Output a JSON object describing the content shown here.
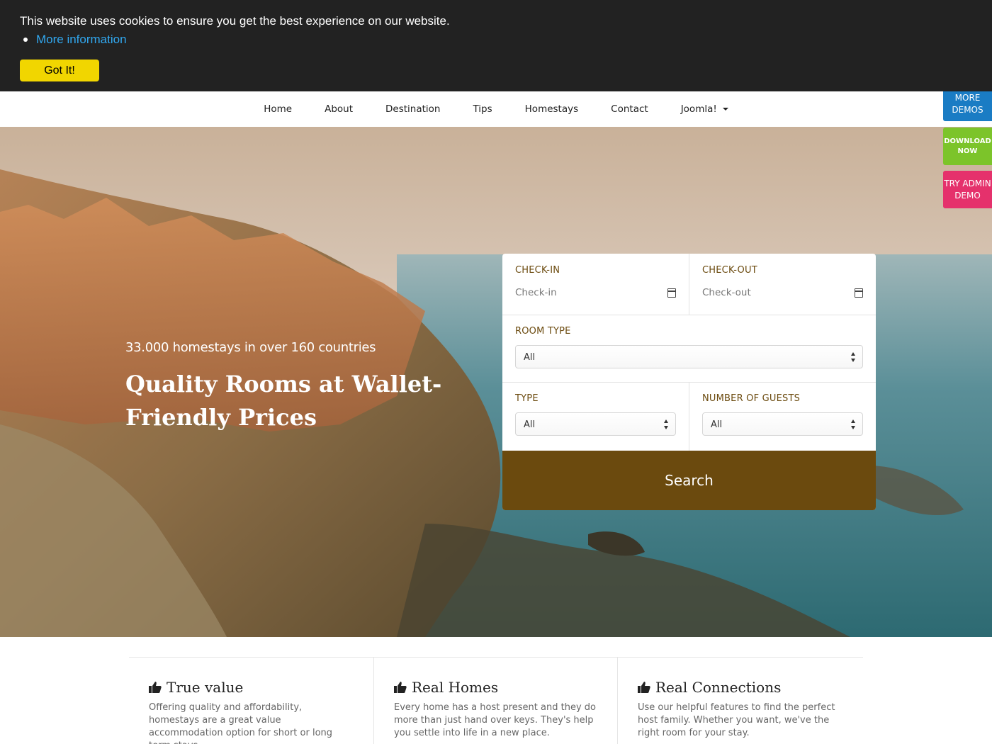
{
  "cookie": {
    "message": "This website uses cookies to ensure you get the best experience on our website.",
    "link_label": "More information",
    "button_label": "Got It!"
  },
  "nav": {
    "items": [
      "Home",
      "About",
      "Destination",
      "Tips",
      "Homestays",
      "Contact",
      "Joomla!"
    ]
  },
  "side_buttons": {
    "more_demos": "MORE DEMOS",
    "download_now": "DOWNLOAD NOW",
    "try_admin": "TRY ADMIN DEMO"
  },
  "hero": {
    "tagline": "33.000 homestays in over 160 countries",
    "headline": "Quality Rooms at Wallet-Friendly Prices"
  },
  "search_form": {
    "checkin_label": "CHECK-IN",
    "checkin_placeholder": "Check-in",
    "checkout_label": "CHECK-OUT",
    "checkout_placeholder": "Check-out",
    "room_type_label": "ROOM TYPE",
    "room_type_value": "All",
    "type_label": "TYPE",
    "type_value": "All",
    "guests_label": "NUMBER OF GUESTS",
    "guests_value": "All",
    "search_label": "Search",
    "accent_color": "#6b4a0e"
  },
  "features": [
    {
      "title": "True value",
      "icon": "thumbs-up-icon",
      "desc": "Offering quality and affordability, homestays are a great value accommodation option for short or long term stays"
    },
    {
      "title": "Real Homes",
      "icon": "thumbs-up-icon",
      "desc": "Every home has a host present and they do more than just hand over keys. They's help you settle into life in a new place."
    },
    {
      "title": "Real Connections",
      "icon": "thumbs-up-icon",
      "desc": "Use our helpful features to find the perfect host family. Whether you want, we've the right room for your stay."
    }
  ]
}
